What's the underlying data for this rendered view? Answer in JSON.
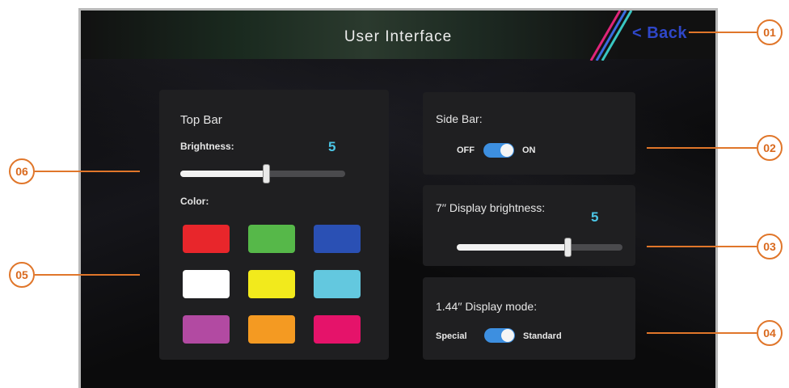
{
  "header": {
    "title": "User Interface",
    "back_label": "< Back"
  },
  "top_bar": {
    "title": "Top Bar",
    "brightness_label": "Brightness:",
    "brightness_value": "5",
    "brightness_level": 0.52,
    "color_label": "Color:",
    "colors": [
      "#e8262b",
      "#56b849",
      "#2a50b4",
      "#ffffff",
      "#f2ea1c",
      "#63c8df",
      "#b24aa2",
      "#f49a22",
      "#e5136a"
    ]
  },
  "side_bar": {
    "label": "Side Bar:",
    "off_label": "OFF",
    "on_label": "ON",
    "state": "ON"
  },
  "display7": {
    "label": "7′′ Display brightness:",
    "value": "5",
    "level": 0.67
  },
  "display144": {
    "label": "1.44′′  Display mode:",
    "left_label": "Special",
    "right_label": "Standard",
    "state": "Standard"
  },
  "callouts": [
    "01",
    "02",
    "03",
    "04",
    "05",
    "06"
  ]
}
